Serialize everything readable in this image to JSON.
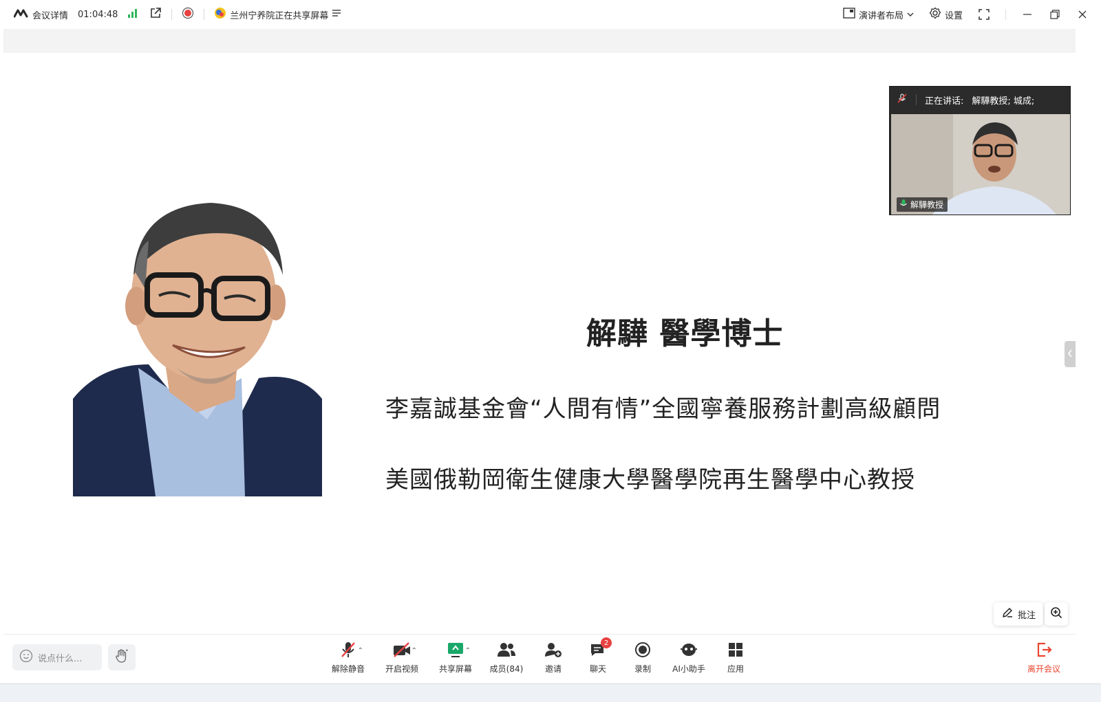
{
  "titlebar": {
    "meeting_details": "会议详情",
    "elapsed_time": "01:04:48",
    "sharing_status": "兰州宁养院正在共享屏幕",
    "layout_label": "演讲者布局",
    "settings_label": "设置"
  },
  "slide": {
    "title": "解驊 醫學博士",
    "line1": "李嘉誠基金會“人間有情”全國寧養服務計劃高級顧問",
    "line2": "美國俄勒岡衛生健康大學醫學院再生醫學中心教授"
  },
  "video_panel": {
    "speaking_label": "正在讲话:",
    "speaking_names": "解驊教授; 城成;",
    "participant_name": "解驊教授"
  },
  "annotation": {
    "label": "批注"
  },
  "controls": {
    "chat_placeholder": "说点什么...",
    "unmute": "解除静音",
    "start_video": "开启视频",
    "share_screen": "共享屏幕",
    "members": "成员(84)",
    "invite": "邀请",
    "chat": "聊天",
    "chat_badge": "2",
    "record": "录制",
    "ai_assistant": "AI小助手",
    "apps": "应用",
    "leave": "离开会议"
  },
  "colors": {
    "signal_green": "#2fb65a",
    "record_red": "#e84141",
    "share_green": "#1aa86a",
    "leave_red": "#e8452e"
  }
}
